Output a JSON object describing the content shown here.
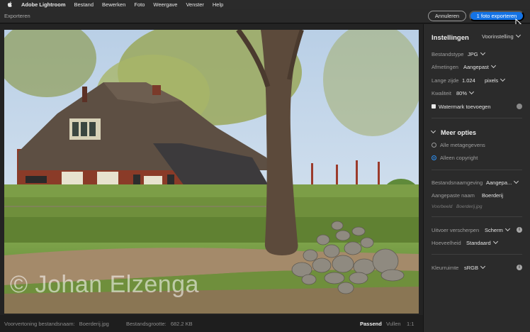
{
  "menubar": {
    "app_name": "Adobe Lightroom",
    "items": [
      "Bestand",
      "Bewerken",
      "Foto",
      "Weergave",
      "Venster",
      "Help"
    ]
  },
  "header": {
    "title": "Exporteren",
    "cancel_label": "Annuleren",
    "export_label": "1 foto exporteren"
  },
  "preview": {
    "watermark_text": "© Johan Elzenga",
    "filename_label": "Voorvertoning bestandsnaam:",
    "filename_value": "Boerderij.jpg",
    "filesize_label": "Bestandsgrootte:",
    "filesize_value": "682.2 KB",
    "zoom_options": [
      "Passend",
      "Vullen",
      "1:1"
    ],
    "active_zoom": "Passend"
  },
  "settings": {
    "title": "Instellingen",
    "preset_label": "Voorinstelling",
    "file_type_label": "Bestandstype",
    "file_type_value": "JPG",
    "dimensions_label": "Afmetingen",
    "dimensions_value": "Aangepast",
    "long_side_label": "Lange zijde",
    "long_side_value": "1.024",
    "long_side_unit": "pixels",
    "quality_label": "Kwaliteit",
    "quality_value": "80%",
    "watermark_label": "Watermark toevoegen",
    "watermark_checked": true
  },
  "more_options": {
    "title": "Meer opties",
    "metadata_options": [
      "Alle metagegevens",
      "Alleen copyright"
    ],
    "metadata_selected": "Alleen copyright",
    "naming_label": "Bestandsnaamgeving",
    "naming_value": "Aangepa...",
    "custom_name_label": "Aangepaste naam",
    "custom_name_value": "Boerderij",
    "example_label": "Voorbeeld",
    "example_value": "Boerderij.jpg",
    "sharpen_label": "Uitvoer verscherpen",
    "sharpen_value": "Scherm",
    "amount_label": "Hoeveelheid",
    "amount_value": "Standaard",
    "colorspace_label": "Kleurruimte",
    "colorspace_value": "sRGB"
  },
  "colors": {
    "accent": "#1473e6",
    "panel_bg": "#2b2b2b",
    "app_bg": "#1d1d1d"
  }
}
